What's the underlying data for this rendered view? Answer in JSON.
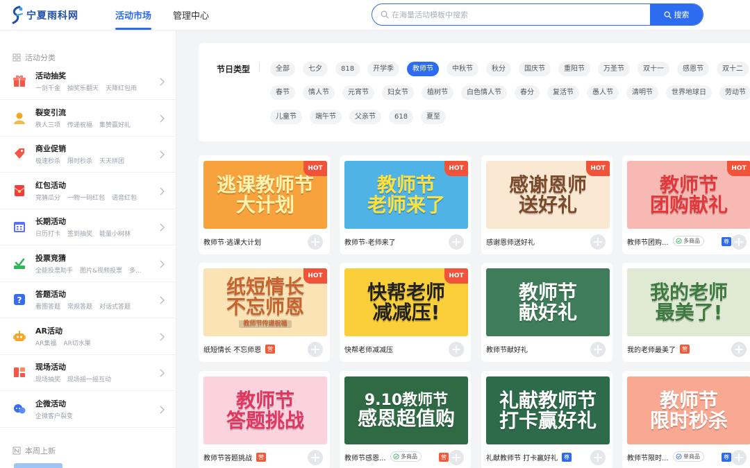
{
  "header": {
    "logo_text": "宁夏雨科网",
    "nav": [
      {
        "label": "活动市场",
        "active": true
      },
      {
        "label": "管理中心",
        "active": false
      }
    ],
    "search": {
      "placeholder": "在海量活动模板中搜索",
      "value": "",
      "button_label": "搜索"
    }
  },
  "colors": {
    "accent": "#2d6cf0",
    "hot": "#f0533a"
  },
  "sidebar": {
    "section_title": "活动分类",
    "categories": [
      {
        "title": "活动抽奖",
        "icon": "gift-icon",
        "subs": [
          "一剑千金",
          "抽奖乐翻天",
          "天降红包雨"
        ]
      },
      {
        "title": "裂变引流",
        "icon": "user-icon",
        "subs": [
          "秩人三项",
          "传递祝福",
          "集赞赢好礼"
        ]
      },
      {
        "title": "商业促销",
        "icon": "tag-icon",
        "subs": [
          "极速秒杀",
          "限时秒杀",
          "天天拼团"
        ]
      },
      {
        "title": "红包活动",
        "icon": "red-envelope-icon",
        "subs": [
          "竞猜瓜分",
          "一物一码红包",
          "语音红包"
        ]
      },
      {
        "title": "长期活动",
        "icon": "calendar-icon",
        "subs": [
          "日历打卡",
          "签到抽奖",
          "能量小树林"
        ]
      },
      {
        "title": "投票竞猜",
        "icon": "vote-icon",
        "subs": [
          "全能投票助手",
          "图片&视频投票",
          "多..."
        ]
      },
      {
        "title": "答题活动",
        "icon": "question-icon",
        "subs": [
          "看图答题",
          "常规答题",
          "对话式答题"
        ]
      },
      {
        "title": "AR活动",
        "icon": "robot-icon",
        "subs": [
          "AR集福",
          "AR切水果"
        ]
      },
      {
        "title": "现场活动",
        "icon": "stage-icon",
        "subs": [
          "现场抽奖",
          "现场摇一摇互动"
        ]
      },
      {
        "title": "企微活动",
        "icon": "chat-icon",
        "subs": [
          "企微客户裂变"
        ]
      }
    ],
    "weekly_title": "本周上新"
  },
  "filter": {
    "label": "节日类型",
    "rows": [
      [
        "全部",
        "七夕",
        "818",
        "开学季",
        "教师节",
        "中秋节",
        "秋分",
        "国庆节",
        "重阳节",
        "万圣节",
        "双十一",
        "感恩节",
        "双十二"
      ],
      [
        "春节",
        "情人节",
        "元宵节",
        "妇女节",
        "植树节",
        "白色情人节",
        "春分",
        "复活节",
        "愚人节",
        "清明节",
        "世界地球日",
        "劳动节"
      ],
      [
        "儿童节",
        "端午节",
        "父亲节",
        "618",
        "夏至"
      ]
    ],
    "active": "教师节"
  },
  "cards": [
    {
      "title": "教师节·逃课大计划",
      "hot": "HOT",
      "banner": [
        "逃课教师节",
        "大计划"
      ],
      "bg": "#f7a23c",
      "fg": "#fff3b0",
      "badge": "",
      "goods": ""
    },
    {
      "title": "教师节-老师来了",
      "hot": "HOT",
      "banner": [
        "教师节",
        "老师来了"
      ],
      "bg": "#4fb3e6",
      "fg": "#ffe13a",
      "badge": "",
      "goods": ""
    },
    {
      "title": "感谢恩师送好礼",
      "hot": "HOT",
      "banner": [
        "感谢恩师",
        "送好礼"
      ],
      "bg": "#fbe8d3",
      "fg": "#7a4b2a",
      "badge": "",
      "goods": ""
    },
    {
      "title": "教师节团购...",
      "hot": "HOT",
      "banner": [
        "教师节",
        "团购献礼"
      ],
      "bg": "#f7b9b4",
      "fg": "#e2383c",
      "badge": "尊",
      "goods": "多商品"
    },
    {
      "title": "纸短情长 不忘师恩",
      "hot": "HOT",
      "banner": [
        "纸短情长",
        "不忘师恩",
        "教师节传递祝福"
      ],
      "bg": "#fbe3b6",
      "fg": "#c8632f",
      "badge": "营",
      "goods": ""
    },
    {
      "title": "快帮老师减减压",
      "hot": "HOT",
      "banner": [
        "快帮老师",
        "减减压!"
      ],
      "bg": "#fbcf3a",
      "fg": "#222",
      "badge": "",
      "goods": ""
    },
    {
      "title": "教师节献好礼",
      "hot": "",
      "banner": [
        "教师节",
        "献好礼"
      ],
      "bg": "#3f7d5a",
      "fg": "#fff",
      "badge": "",
      "goods": ""
    },
    {
      "title": "我的老师最美了",
      "hot": "",
      "banner": [
        "我的老师",
        "最美了!"
      ],
      "bg": "#dfe9d3",
      "fg": "#3c7a3f",
      "badge": "营",
      "goods": ""
    },
    {
      "title": "教师节答题挑战",
      "hot": "",
      "banner": [
        "教师节",
        "答题挑战"
      ],
      "bg": "#fbd3df",
      "fg": "#e0365f",
      "badge": "营",
      "goods": ""
    },
    {
      "title": "教师节感恩...",
      "hot": "",
      "banner": [
        "9.10教师节",
        "感恩超值购"
      ],
      "bg": "#2f6a45",
      "fg": "#fff",
      "badge": "营",
      "goods": "多商品"
    },
    {
      "title": "礼献教师节 打卡赢好礼",
      "hot": "",
      "banner": [
        "礼献教师节",
        "打卡赢好礼"
      ],
      "bg": "#2e6b4b",
      "fg": "#fff",
      "badge": "尊",
      "goods": ""
    },
    {
      "title": "教师节限时...",
      "hot": "",
      "banner": [
        "教师节",
        "限时秒杀"
      ],
      "bg": "#f9a891",
      "fg": "#fff",
      "badge": "尊",
      "goods": "单商品"
    }
  ]
}
